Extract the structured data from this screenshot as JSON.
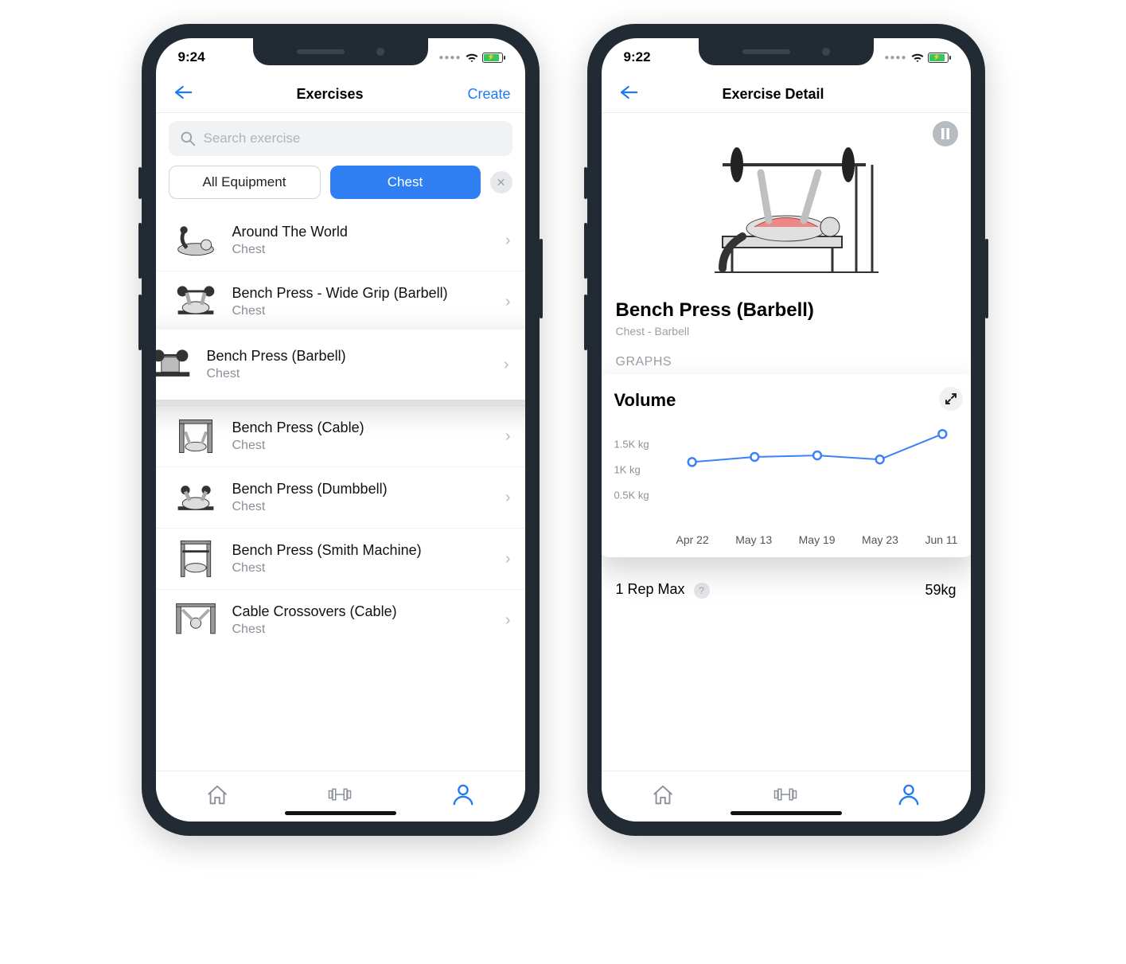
{
  "left": {
    "status": {
      "time": "9:24"
    },
    "nav": {
      "title": "Exercises",
      "action": "Create"
    },
    "search": {
      "placeholder": "Search exercise"
    },
    "filters": {
      "equipment": "All Equipment",
      "muscle": "Chest"
    },
    "highlight_index": 2,
    "exercises": [
      {
        "name": "Around The World",
        "muscle": "Chest"
      },
      {
        "name": "Bench Press - Wide Grip (Barbell)",
        "muscle": "Chest"
      },
      {
        "name": "Bench Press (Barbell)",
        "muscle": "Chest"
      },
      {
        "name": "Bench Press (Cable)",
        "muscle": "Chest"
      },
      {
        "name": "Bench Press (Dumbbell)",
        "muscle": "Chest"
      },
      {
        "name": "Bench Press (Smith Machine)",
        "muscle": "Chest"
      },
      {
        "name": "Cable Crossovers (Cable)",
        "muscle": "Chest"
      }
    ]
  },
  "right": {
    "status": {
      "time": "9:22"
    },
    "nav": {
      "title": "Exercise Detail"
    },
    "detail": {
      "title": "Bench Press (Barbell)",
      "subtitle": "Chest - Barbell",
      "section": "GRAPHS"
    },
    "card": {
      "title": "Volume"
    },
    "onerep": {
      "label": "1 Rep Max",
      "value": "59kg"
    }
  },
  "chart_data": {
    "type": "line",
    "title": "Volume",
    "xlabel": "",
    "ylabel": "kg",
    "ylim": [
      0,
      2000
    ],
    "yticks": [
      500,
      1000,
      1500
    ],
    "ytick_labels": [
      "0.5K kg",
      "1K kg",
      "1.5K kg"
    ],
    "categories": [
      "Apr 22",
      "May 13",
      "May 19",
      "May 23",
      "Jun 11"
    ],
    "values": [
      1150,
      1250,
      1280,
      1200,
      1700
    ]
  }
}
